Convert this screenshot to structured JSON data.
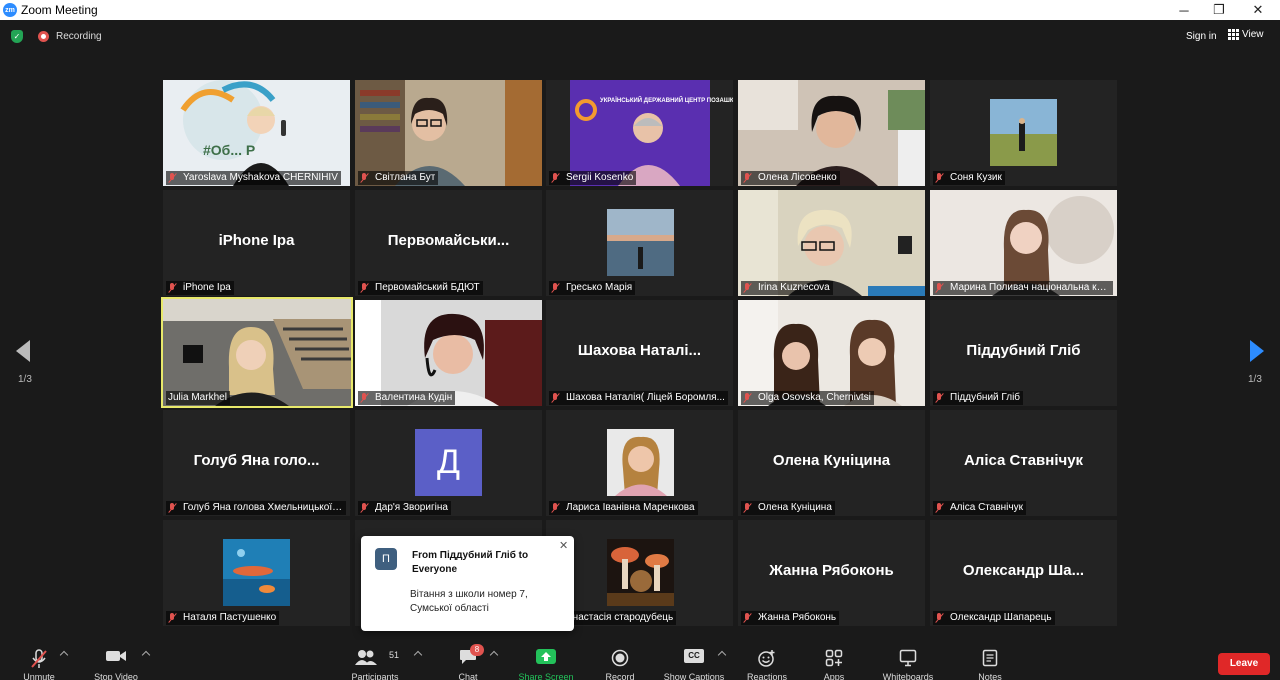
{
  "window": {
    "title": "Zoom Meeting",
    "controls": [
      "─",
      "❐",
      "✕"
    ]
  },
  "topbar": {
    "recording": "Recording",
    "signin": "Sign in",
    "view": "View"
  },
  "tiles": [
    {
      "name": "Yaroslava Myshakova CHERNIHIV",
      "big": ""
    },
    {
      "name": "Світлана Бут",
      "big": ""
    },
    {
      "name": "Sergii Kosenko",
      "big": ""
    },
    {
      "name": "Олена Лісовенко",
      "big": ""
    },
    {
      "name": "Соня Кузик",
      "big": ""
    },
    {
      "name": "iPhone Ipa",
      "big": "iPhone Ipa"
    },
    {
      "name": "Первомайський БДЮТ",
      "big": "Первомайськи..."
    },
    {
      "name": "Гресько Марія",
      "big": ""
    },
    {
      "name": "Irina Kuznecova",
      "big": ""
    },
    {
      "name": "Марина Поливач національна ко...",
      "big": ""
    },
    {
      "name": "Julia Markhel",
      "big": ""
    },
    {
      "name": "Валентина Кудін",
      "big": ""
    },
    {
      "name": "Шахова Наталія( Ліцей Боромля...",
      "big": "Шахова Наталі..."
    },
    {
      "name": "Olga Osovska, Chernivtsi",
      "big": ""
    },
    {
      "name": "Піддубний Гліб",
      "big": "Піддубний Гліб"
    },
    {
      "name": "Голуб Яна голова Хмельницької ...",
      "big": "Голуб Яна голо..."
    },
    {
      "name": "Дар'я Зворигіна",
      "big": "",
      "avatar_letter": "Д"
    },
    {
      "name": "Лариса Іванівна Маренкова",
      "big": ""
    },
    {
      "name": "Олена Куніцина",
      "big": "Олена Куніцина"
    },
    {
      "name": "Аліса Ставнічук",
      "big": "Аліса Ставнічук"
    },
    {
      "name": "Наталя Пастушенко",
      "big": ""
    },
    {
      "name": "",
      "big": ""
    },
    {
      "name": "Анастасія стародубець",
      "big": ""
    },
    {
      "name": "Жанна Рябоконь",
      "big": "Жанна Рябоконь"
    },
    {
      "name": "Олександр Шапарець",
      "big": "Олександр Ша..."
    }
  ],
  "sergii_banner": "УКРАЇНСЬКИЙ ДЕРЖАВНИЙ ЦЕНТР ПОЗАШКІЛЬНОЇ ОСВІТИ",
  "yaroslava_banner": "#Об... Р",
  "pager": {
    "left": "1/3",
    "right": "1/3"
  },
  "chat_popup": {
    "avatar": "П",
    "from": "From Піддубний Гліб to Everyone",
    "message": "Вітання з школи номер 7, Сумської області",
    "close": "✕"
  },
  "toolbar": {
    "unmute": "Unmute",
    "stop_video": "Stop Video",
    "participants": "Participants",
    "participants_count": "51",
    "chat": "Chat",
    "chat_badge": "8",
    "share_screen": "Share Screen",
    "record": "Record",
    "show_captions": "Show Captions",
    "cc": "CC",
    "reactions": "Reactions",
    "apps": "Apps",
    "whiteboards": "Whiteboards",
    "notes": "Notes",
    "leave": "Leave"
  },
  "colors": {
    "background": "#1a1a1a",
    "tile": "#232323",
    "active_speaker": "#e8e96b",
    "zoom_blue": "#2d8cff",
    "leave_red": "#e02828",
    "share_green": "#23c15a"
  }
}
